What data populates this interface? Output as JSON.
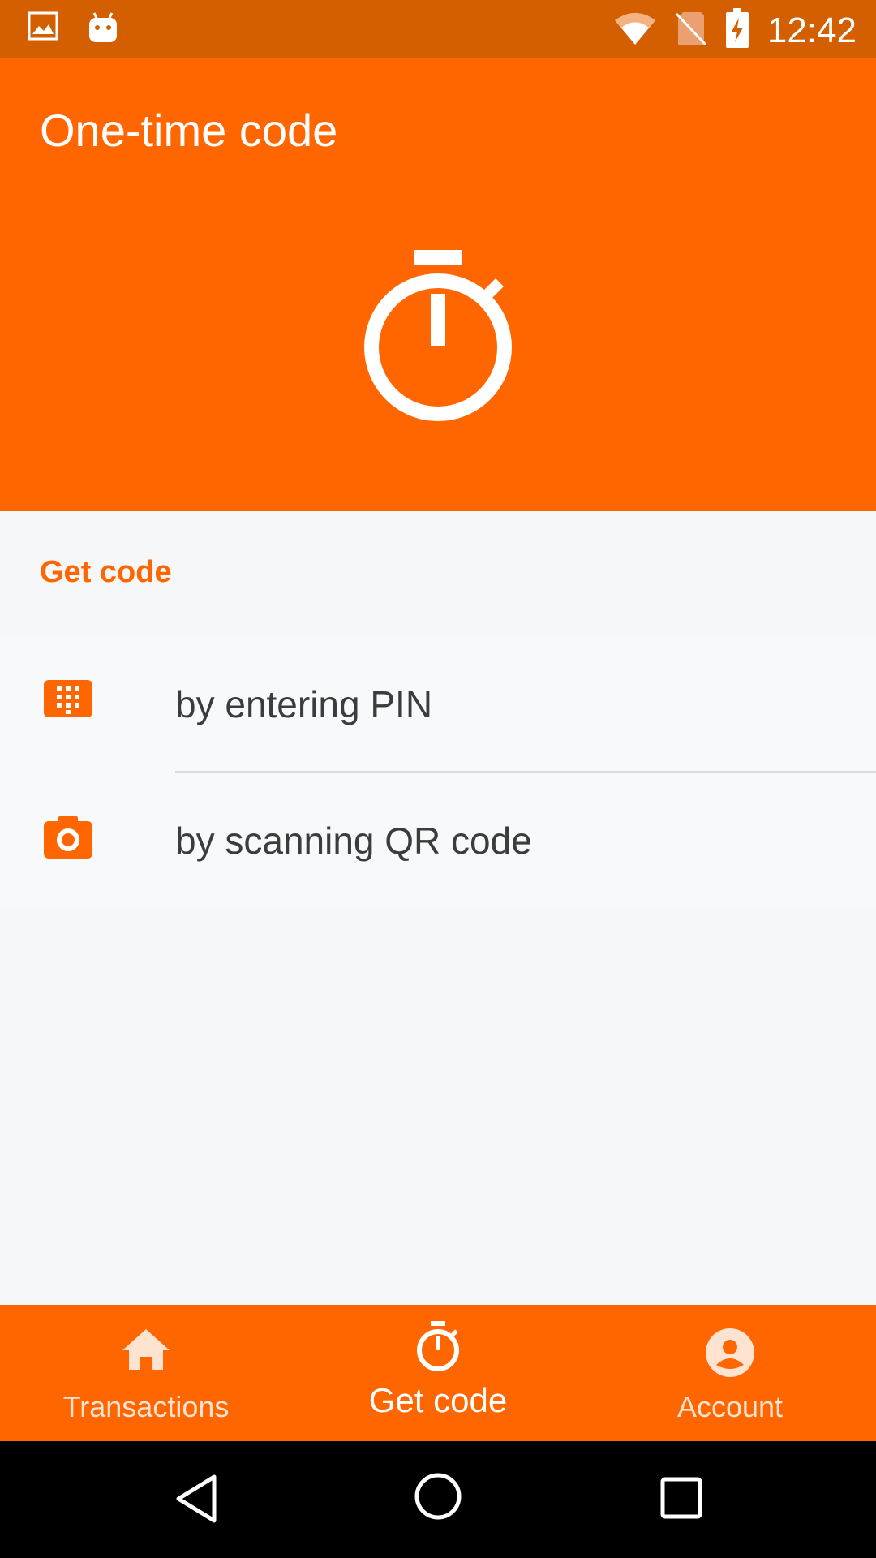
{
  "status_bar": {
    "time": "12:42",
    "icons": [
      "image-icon",
      "android-icon",
      "wifi-icon",
      "no-sim-icon",
      "battery-charging-icon"
    ]
  },
  "app_bar": {
    "title": "One-time code",
    "hero_icon": "stopwatch-icon",
    "color": "#ff6600"
  },
  "section": {
    "header": "Get code",
    "items": [
      {
        "label": "by entering PIN",
        "icon": "dialpad-icon"
      },
      {
        "label": "by scanning QR code",
        "icon": "camera-icon"
      }
    ]
  },
  "bottom_nav": {
    "items": [
      {
        "label": "Transactions",
        "icon": "home-icon",
        "active": false
      },
      {
        "label": "Get code",
        "icon": "stopwatch-icon",
        "active": true
      },
      {
        "label": "Account",
        "icon": "account-circle-icon",
        "active": false
      }
    ]
  },
  "system_nav": [
    "back-icon",
    "home-circle-icon",
    "recents-icon"
  ],
  "colors": {
    "accent": "#ff6600",
    "status_bar": "#d35f00",
    "background": "#f5f7f8",
    "text": "#3c3c3c"
  }
}
